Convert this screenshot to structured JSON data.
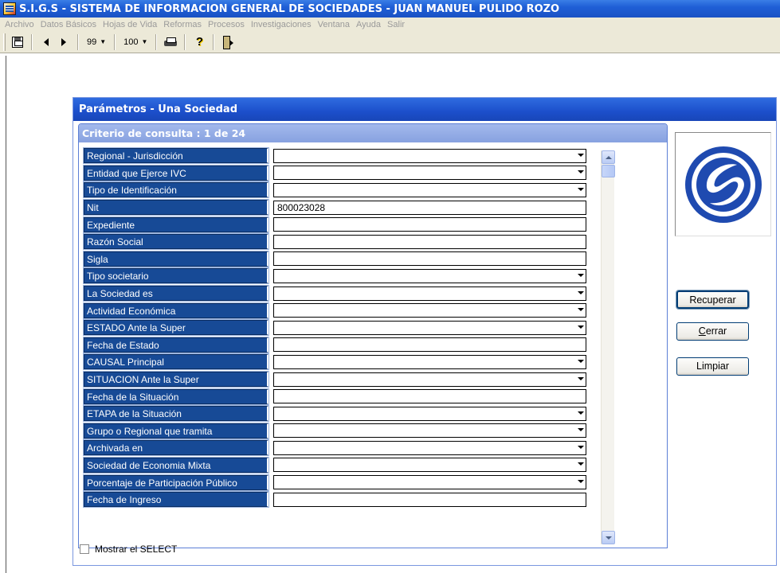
{
  "window": {
    "title": "S.I.G.S  - SISTEMA DE INFORMACION GENERAL DE SOCIEDADES - JUAN MANUEL PULIDO ROZO"
  },
  "menu": {
    "items": [
      "Archivo",
      "Datos Básicos",
      "Hojas de Vida",
      "Reformas",
      "Procesos",
      "Investigaciones",
      "Ventana",
      "Ayuda",
      "Salir"
    ]
  },
  "toolbar": {
    "combo1": "99",
    "combo2": "100"
  },
  "panel": {
    "title": "Parámetros -  Una Sociedad",
    "group_title": "Criterio de consulta : 1  de  24",
    "rows": [
      {
        "label": "Regional - Jurisdicción",
        "value": "",
        "dropdown": true
      },
      {
        "label": "Entidad que Ejerce IVC",
        "value": "",
        "dropdown": true
      },
      {
        "label": "Tipo de Identificación",
        "value": "",
        "dropdown": true
      },
      {
        "label": "Nit",
        "value": "800023028",
        "dropdown": false
      },
      {
        "label": "Expediente",
        "value": "",
        "dropdown": false
      },
      {
        "label": "Razón Social",
        "value": "",
        "dropdown": false
      },
      {
        "label": "Sigla",
        "value": "",
        "dropdown": false
      },
      {
        "label": "Tipo societario",
        "value": "",
        "dropdown": true
      },
      {
        "label": "La Sociedad es",
        "value": "",
        "dropdown": true
      },
      {
        "label": "Actividad Económica",
        "value": "",
        "dropdown": true
      },
      {
        "label": "ESTADO Ante la Super",
        "value": "",
        "dropdown": true
      },
      {
        "label": "Fecha de Estado",
        "value": "",
        "dropdown": false
      },
      {
        "label": "CAUSAL Principal",
        "value": "",
        "dropdown": true
      },
      {
        "label": "SITUACION Ante la Super",
        "value": "",
        "dropdown": true
      },
      {
        "label": "Fecha de la Situación",
        "value": "",
        "dropdown": false
      },
      {
        "label": "ETAPA de la Situación",
        "value": "",
        "dropdown": true
      },
      {
        "label": "Grupo o Regional que tramita",
        "value": "",
        "dropdown": true
      },
      {
        "label": "Archivada en",
        "value": "",
        "dropdown": true
      },
      {
        "label": "Sociedad de Economia Mixta",
        "value": "",
        "dropdown": true
      },
      {
        "label": "Porcentaje de Participación Público",
        "value": "",
        "dropdown": true
      },
      {
        "label": "Fecha de Ingreso",
        "value": "",
        "dropdown": false
      }
    ],
    "buttons": {
      "recuperar": "Recuperar",
      "cerrar_pre": "C",
      "cerrar_rest": "errar",
      "limpiar": "Limpiar"
    },
    "checkbox_label": "Mostrar el SELECT"
  },
  "colors": {
    "label_bg": "#174a96",
    "title_blue": "#1c4fcb",
    "logo_blue": "#1f4ab0"
  },
  "icons": [
    "save-icon",
    "prev-icon",
    "next-icon",
    "printer-icon",
    "help-icon",
    "exit-icon",
    "scroll-up-icon",
    "scroll-down-icon"
  ]
}
